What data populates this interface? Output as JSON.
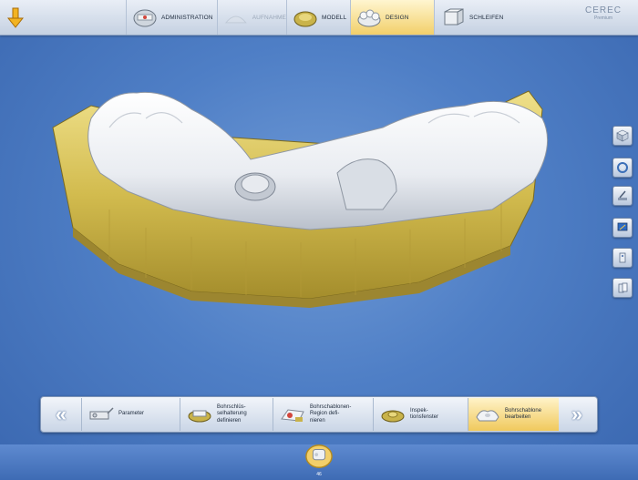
{
  "topbar": {
    "phases": [
      {
        "label": "ADMINISTRATION",
        "icon": "administration-icon",
        "state": "normal"
      },
      {
        "label": "AUFNAHME",
        "icon": "aufnahme-icon",
        "state": "disabled"
      },
      {
        "label": "MODELL",
        "icon": "modell-icon",
        "state": "normal"
      },
      {
        "label": "DESIGN",
        "icon": "design-icon",
        "state": "active"
      },
      {
        "label": "SCHLEIFEN",
        "icon": "schleifen-icon",
        "state": "normal"
      }
    ],
    "logo_line1": "CEREC",
    "logo_line2": "Premium"
  },
  "right_toolbar": [
    "view-cube-icon",
    "rotate-icon",
    "tool-icon",
    "monitor-icon",
    "info-icon",
    "catalog-icon"
  ],
  "stepbar": {
    "prev_label": "«",
    "next_label": "»",
    "steps": [
      {
        "label": "Parameter",
        "state": "normal"
      },
      {
        "label": "Bohrschlüs-\nselhalterung\ndefinieren",
        "state": "normal"
      },
      {
        "label": "Bohrschablonen-\nRegion defi-\nnieren",
        "state": "normal"
      },
      {
        "label": "Inspek-\ntionsfenster",
        "state": "normal"
      },
      {
        "label": "Bohrschablone\nbearbeiten",
        "state": "active"
      }
    ]
  },
  "tray": {
    "label": "46"
  },
  "colors": {
    "accent": "#f2cf6a",
    "background": "#4f7fc6",
    "model": "#d8c45c",
    "guide": "#eef0f3"
  }
}
